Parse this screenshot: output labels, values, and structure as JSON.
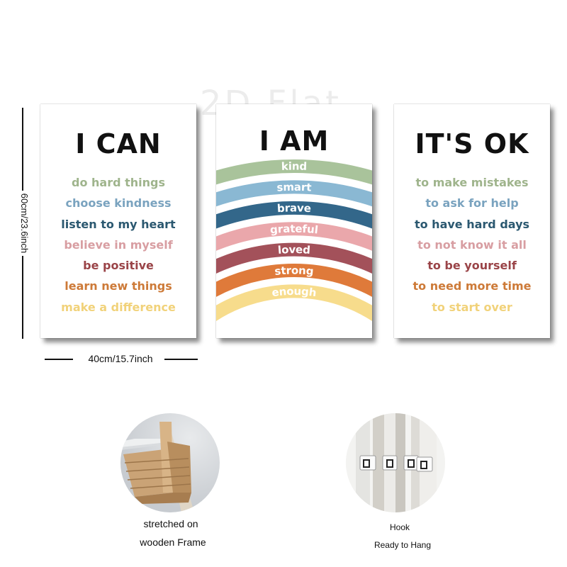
{
  "watermark": "2D Flat",
  "posters": [
    {
      "title": "I CAN",
      "phrases": [
        {
          "text": "do hard things",
          "color": "#9fb48c"
        },
        {
          "text": "choose kindness",
          "color": "#7aa3bf"
        },
        {
          "text": "listen to my heart",
          "color": "#2b5870"
        },
        {
          "text": "believe in myself",
          "color": "#d89ea2"
        },
        {
          "text": "be positive",
          "color": "#9a4448"
        },
        {
          "text": "learn new things",
          "color": "#cd7a38"
        },
        {
          "text": "make a difference",
          "color": "#f1d27a"
        }
      ]
    },
    {
      "title": "I AM",
      "bands": [
        {
          "text": "kind",
          "color": "#a9c39b"
        },
        {
          "text": "smart",
          "color": "#8ab8d3"
        },
        {
          "text": "brave",
          "color": "#33678a"
        },
        {
          "text": "grateful",
          "color": "#eaa7ab"
        },
        {
          "text": "loved",
          "color": "#a3515a"
        },
        {
          "text": "strong",
          "color": "#df7a3a"
        },
        {
          "text": "enough",
          "color": "#f7dc8c"
        }
      ]
    },
    {
      "title": "IT'S OK",
      "phrases": [
        {
          "text": "to make mistakes",
          "color": "#9fb48c"
        },
        {
          "text": "to ask for help",
          "color": "#7aa3bf"
        },
        {
          "text": "to have hard days",
          "color": "#2b5870"
        },
        {
          "text": "to not know it all",
          "color": "#d89ea2"
        },
        {
          "text": "to be yourself",
          "color": "#9a4448"
        },
        {
          "text": "to need more time",
          "color": "#cd7a38"
        },
        {
          "text": "to start over",
          "color": "#f1d27a"
        }
      ]
    }
  ],
  "dimensions": {
    "height_label": "60cm/23.6inch",
    "width_label": "40cm/15.7inch"
  },
  "features": [
    {
      "caption_lines": [
        "stretched on",
        "wooden Frame"
      ]
    },
    {
      "caption_lines": [
        "Hook",
        "Ready to Hang"
      ]
    }
  ]
}
